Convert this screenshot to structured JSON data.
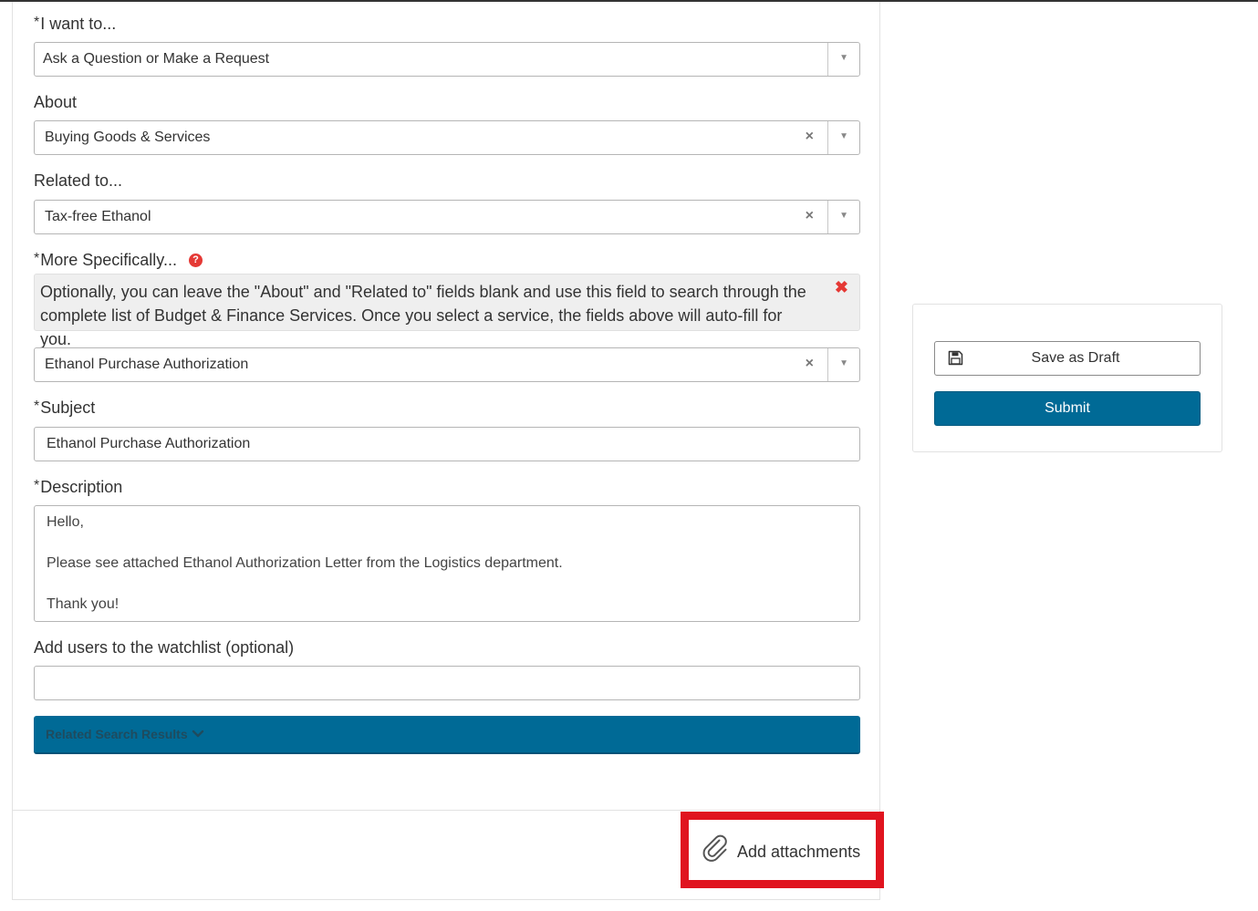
{
  "form": {
    "i_want_to": {
      "required_mark": "*",
      "label": "I want to...",
      "value": "Ask a Question or Make a Request"
    },
    "about": {
      "label": "About",
      "value": "Buying Goods & Services",
      "clear_glyph": "×"
    },
    "related_to": {
      "label": "Related to...",
      "value": "Tax-free Ethanol",
      "clear_glyph": "×"
    },
    "more_specifically": {
      "required_mark": "*",
      "label": "More Specifically...",
      "help_glyph": "?",
      "info_text": "Optionally, you can leave the \"About\" and \"Related to\" fields blank and use this field to search through the complete list of Budget & Finance Services. Once you select a service, the fields above will auto-fill for you.",
      "info_close_glyph": "✖",
      "value": "Ethanol Purchase Authorization",
      "clear_glyph": "×"
    },
    "subject": {
      "required_mark": "*",
      "label": "Subject",
      "value": "Ethanol Purchase Authorization"
    },
    "description": {
      "required_mark": "*",
      "label": "Description",
      "lines": [
        "Hello,",
        "Please see attached Ethanol Authorization Letter from the Logistics department.",
        "Thank you!"
      ]
    },
    "watchlist": {
      "label": "Add users to the watchlist (optional)",
      "value": ""
    },
    "related_results": {
      "label": "Related Search Results",
      "icon": "chevron-down-icon"
    },
    "attachments": {
      "label": "Add attachments",
      "icon": "paperclip-icon"
    },
    "dropdown_arrow": "▼"
  },
  "sidebar": {
    "save_draft": {
      "label": "Save as Draft",
      "icon": "floppy-disk-icon"
    },
    "submit": {
      "label": "Submit"
    }
  },
  "colors": {
    "primary": "#006a96",
    "required_accent": "#e53935",
    "highlight": "#e0141f"
  }
}
